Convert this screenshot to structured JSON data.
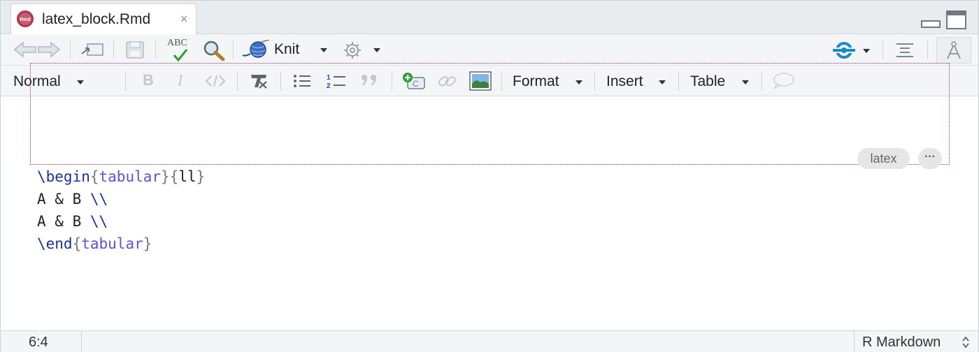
{
  "tab": {
    "title": "latex_block.Rmd",
    "icon": "rmd-file-icon",
    "close": "×",
    "rmd_badge": "Rmd"
  },
  "toolbar": {
    "knit_label": "Knit",
    "spell_label": "ABC"
  },
  "format_bar": {
    "style_label": "Normal",
    "format_label": "Format",
    "insert_label": "Insert",
    "table_label": "Table"
  },
  "editor": {
    "block_label": "latex",
    "more_label": "···",
    "lines": [
      {
        "parts": [
          {
            "cls": "kw",
            "t": "\\begin"
          },
          {
            "cls": "br",
            "t": "{"
          },
          {
            "cls": "arg",
            "t": "tabular"
          },
          {
            "cls": "br",
            "t": "}"
          },
          {
            "cls": "br",
            "t": "{"
          },
          {
            "cls": "plain",
            "t": "ll"
          },
          {
            "cls": "br",
            "t": "}"
          }
        ]
      },
      {
        "parts": [
          {
            "cls": "plain",
            "t": "A & B "
          },
          {
            "cls": "kw",
            "t": "\\\\"
          }
        ]
      },
      {
        "parts": [
          {
            "cls": "plain",
            "t": "A & B "
          },
          {
            "cls": "kw",
            "t": "\\\\"
          }
        ]
      },
      {
        "parts": [
          {
            "cls": "kw",
            "t": "\\end"
          },
          {
            "cls": "br",
            "t": "{"
          },
          {
            "cls": "arg",
            "t": "tabular"
          },
          {
            "cls": "br",
            "t": "}"
          }
        ]
      }
    ]
  },
  "status": {
    "position": "6:4",
    "mode": "R Markdown"
  },
  "colors": {
    "accent": "#1a88c9",
    "block_border": "#9c2a7e",
    "keyword": "#1a2fa0",
    "argument": "#5a54d9"
  }
}
